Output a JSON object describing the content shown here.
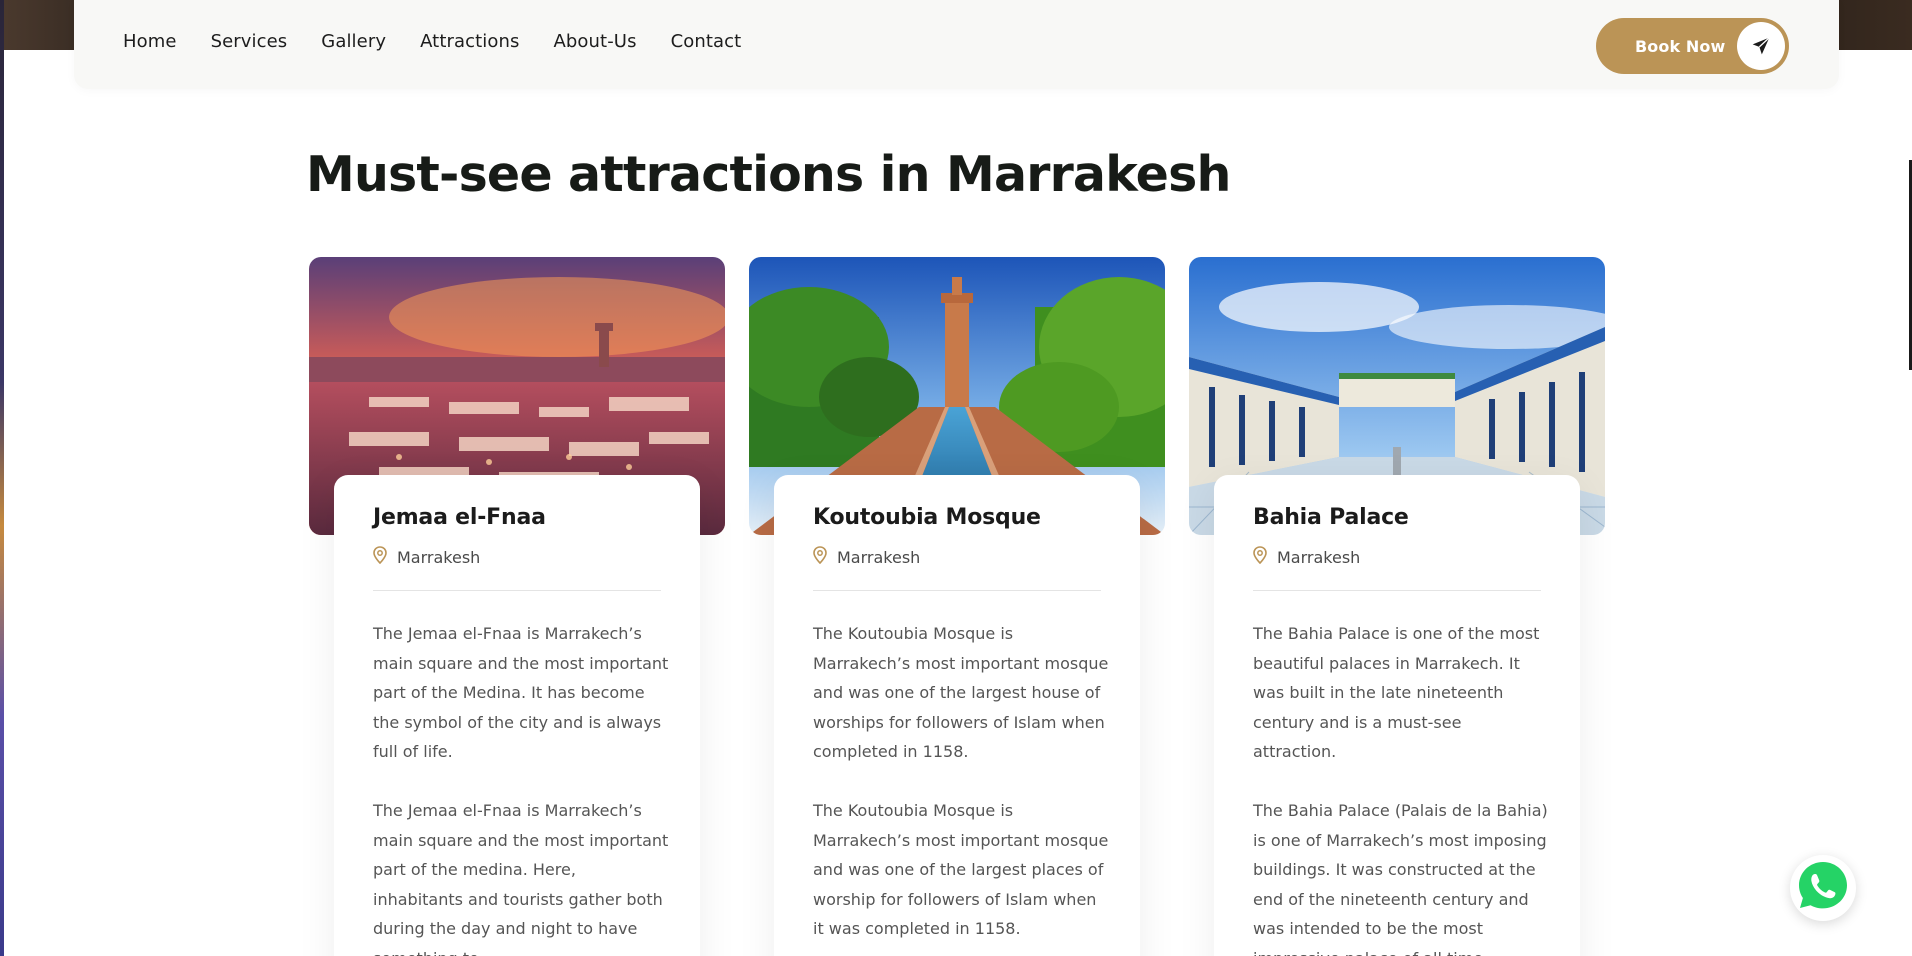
{
  "nav": {
    "links": [
      "Home",
      "Services",
      "Gallery",
      "Attractions",
      "About-Us",
      "Contact"
    ],
    "book_label": "Book Now",
    "book_icon": "paper-plane-icon"
  },
  "page": {
    "title": "Must-see attractions in Marrakesh"
  },
  "cards": [
    {
      "title": "Jemaa el-Fnaa",
      "location": "Marrakesh",
      "paragraphs": [
        "The Jemaa el-Fnaa is Marrakech’s main square and the most important part of the Medina. It has become the symbol of the city and is always full of life.",
        "The Jemaa el-Fnaa is Marrakech’s main square and the most important part of the medina. Here, inhabitants and tourists gather both during the day and night to have something to"
      ]
    },
    {
      "title": "Koutoubia Mosque",
      "location": "Marrakesh",
      "paragraphs": [
        "The Koutoubia Mosque is Marrakech’s most important mosque and was one of the largest house of worships for followers of Islam when completed in 1158.",
        "The Koutoubia Mosque is Marrakech’s most important mosque and was one of the largest places of worship for followers of Islam when it was completed in 1158."
      ]
    },
    {
      "title": "Bahia Palace",
      "location": "Marrakesh",
      "paragraphs": [
        "The Bahia Palace is one of the most beautiful palaces in Marrakech. It was built in the late nineteenth century and is a must-see attraction.",
        "The Bahia Palace (Palais de la Bahia) is one of Marrakech’s most imposing buildings. It was constructed at the end of the nineteenth century and was intended to be the most impressive palace of all time."
      ]
    }
  ],
  "colors": {
    "accent": "#bb9456",
    "text_dark": "#171b17",
    "whatsapp": "#25d366"
  },
  "widgets": {
    "chat_icon": "whatsapp-icon"
  }
}
